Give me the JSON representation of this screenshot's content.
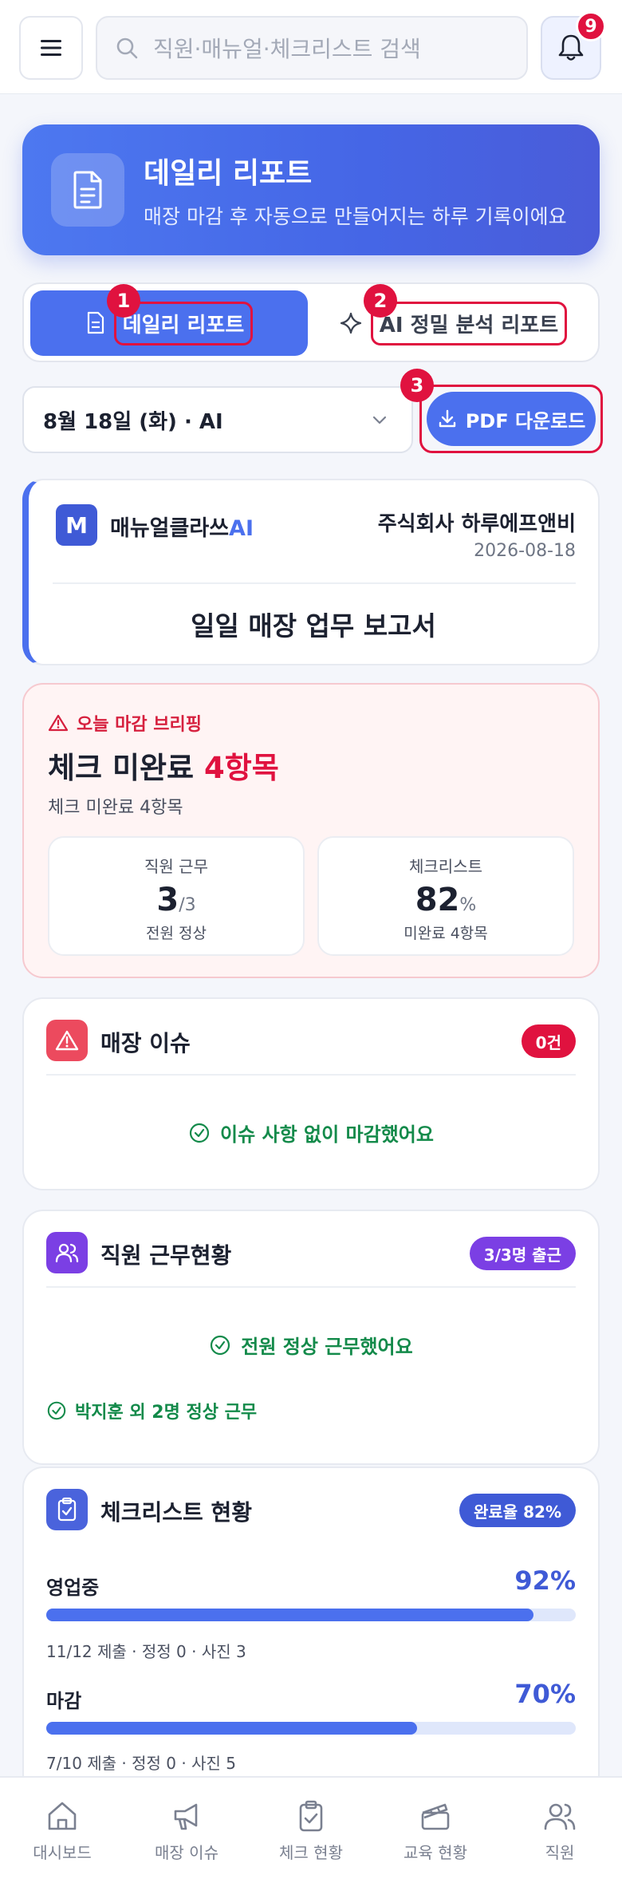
{
  "header": {
    "search_placeholder": "직원·매뉴얼·체크리스트 검색",
    "notification_count": "9"
  },
  "hero": {
    "title": "데일리 리포트",
    "subtitle": "매장 마감 후 자동으로 만들어지는 하루 기록이에요"
  },
  "tabs": [
    {
      "label": "데일리 리포트",
      "active": true
    },
    {
      "label": "AI 정밀 분석 리포트",
      "active": false
    }
  ],
  "markers": [
    "1",
    "2",
    "3"
  ],
  "toolbar": {
    "date_value": "8월 18일 (화) · AI",
    "pdf_label": "PDF 다운로드"
  },
  "report": {
    "logo_letter": "M",
    "brand_name": "매뉴얼클라쓰",
    "brand_suffix": "AI",
    "company": "주식회사 하루에프앤비",
    "date": "2026-08-18",
    "title": "일일 매장 업무 보고서"
  },
  "briefing": {
    "label": "오늘 마감 브리핑",
    "title_prefix": "체크 미완료 ",
    "title_highlight": "4항목",
    "subtitle": "체크 미완료 4항목",
    "stats": [
      {
        "label": "직원 근무",
        "value": "3",
        "unit": "/3",
        "note": "전원 정상"
      },
      {
        "label": "체크리스트",
        "value": "82",
        "unit": "%",
        "note": "미완료 4항목"
      }
    ]
  },
  "issues": {
    "title": "매장 이슈",
    "count_badge": "0건",
    "message": "이슈 사항 없이 마감했어요"
  },
  "staff": {
    "title": "직원 근무현황",
    "badge": "3/3명 출근",
    "message": "전원 정상 근무했어요",
    "note": "박지훈 외 2명 정상 근무"
  },
  "checklist": {
    "title": "체크리스트 현황",
    "badge": "완료율 82%",
    "rows": [
      {
        "name": "영업중",
        "pct_label": "92%",
        "progress": 0.92,
        "meta": "11/12 제출 · 정정 0 · 사진 3"
      },
      {
        "name": "마감",
        "pct_label": "70%",
        "progress": 0.7,
        "meta": "7/10 제출 · 정정 0 · 사진 5"
      }
    ]
  },
  "bottom_nav": [
    {
      "label": "대시보드",
      "icon": "home-icon"
    },
    {
      "label": "매장 이슈",
      "icon": "megaphone-icon"
    },
    {
      "label": "체크 현황",
      "icon": "clipboard-check-icon"
    },
    {
      "label": "교육 현황",
      "icon": "clapperboard-icon"
    },
    {
      "label": "직원",
      "icon": "users-icon"
    }
  ],
  "colors": {
    "accent": "#4b70ee",
    "alert": "#e0123f",
    "success": "#138a4a",
    "purple": "#7b3fe4"
  }
}
